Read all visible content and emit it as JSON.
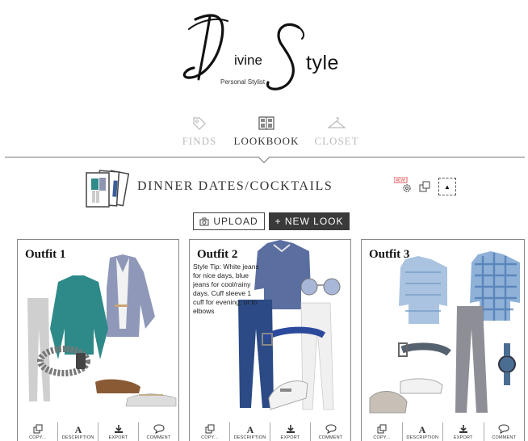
{
  "logo": {
    "script_text": "Divine Style",
    "ivine": "ivine",
    "style": "tyle",
    "subtitle": "Personal Stylist"
  },
  "nav": {
    "items": [
      {
        "label": "FINDS",
        "icon": "tag-icon",
        "active": false
      },
      {
        "label": "LOOKBOOK",
        "icon": "lookbook-icon",
        "active": true
      },
      {
        "label": "CLOSET",
        "icon": "hanger-icon",
        "active": false
      }
    ]
  },
  "lookbook": {
    "title": "DINNER DATES/COCKTAILS",
    "new_badge": "NEW!",
    "collapse_icon": "triangle-up-icon"
  },
  "actions": {
    "upload_label": "UPLOAD",
    "new_look_label": "+ NEW LOOK"
  },
  "outfits": [
    {
      "title": "Outfit 1",
      "tip": "",
      "tools": [
        "COPY...",
        "DESCRIPTION",
        "EXPORT",
        "COMMENT"
      ]
    },
    {
      "title": "Outfit 2",
      "tip": "Style Tip: White jeans for nice days, blue jeans for cool/rainy days. Cuff sleeve 1 cuff for evening; or to elbows",
      "tools": [
        "COPY...",
        "DESCRIPTION",
        "EXPORT",
        "COMMENT"
      ]
    },
    {
      "title": "Outfit 3",
      "tip": "",
      "tools": [
        "COPY...",
        "DESCRIPTION",
        "EXPORT",
        "COMMENT"
      ]
    }
  ],
  "colors": {
    "accent_dark": "#3a3a3a",
    "inactive_nav": "#bbbbbb",
    "border": "#888888"
  }
}
